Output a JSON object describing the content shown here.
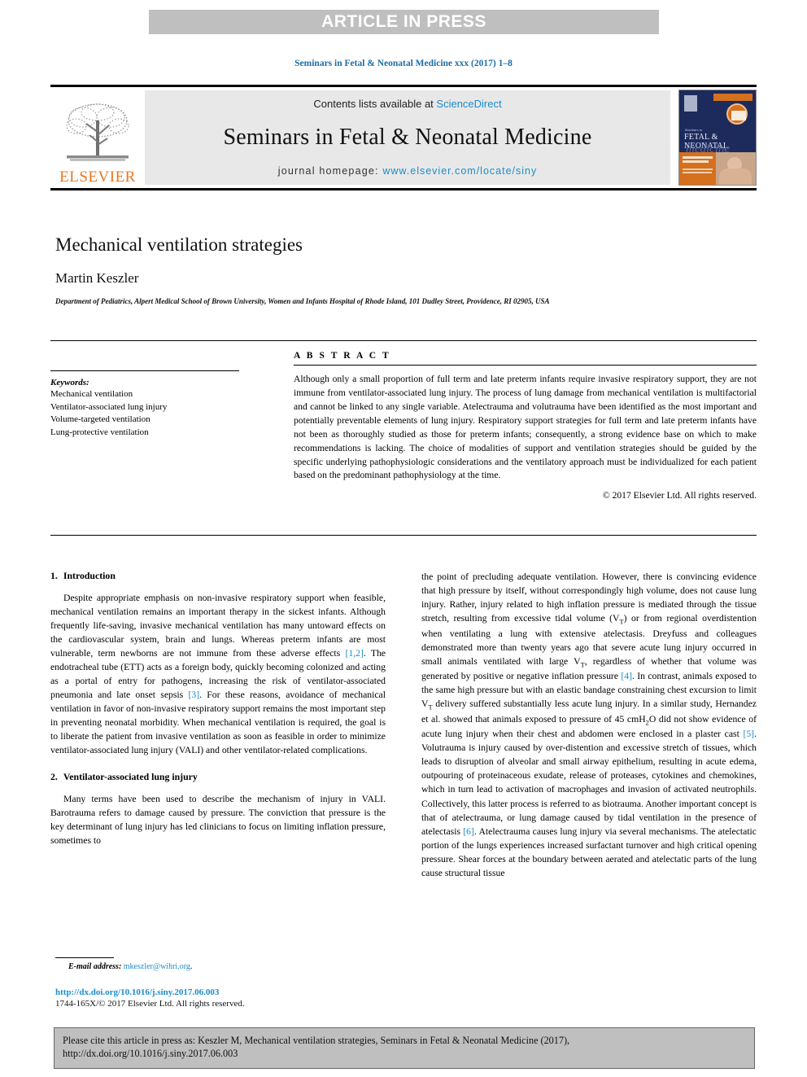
{
  "banner": {
    "label": "ARTICLE IN PRESS"
  },
  "running_head": "Seminars in Fetal & Neonatal Medicine xxx (2017) 1–8",
  "masthead": {
    "publisher_logo_text": "ELSEVIER",
    "contents_prefix": "Contents lists available at ",
    "contents_link": "ScienceDirect",
    "journal_name": "Seminars in Fetal & Neonatal Medicine",
    "homepage_prefix": "journal homepage: ",
    "homepage_url": "www.elsevier.com/locate/siny",
    "cover": {
      "title_small": "Seminars in",
      "title_main": "FETAL & NEONATAL",
      "title_script": "medicine"
    }
  },
  "article": {
    "title": "Mechanical ventilation strategies",
    "author": "Martin Keszler",
    "affiliation": "Department of Pediatrics, Alpert Medical School of Brown University, Women and Infants Hospital of Rhode Island, 101 Dudley Street, Providence, RI 02905, USA"
  },
  "keywords": {
    "heading": "Keywords:",
    "items": [
      "Mechanical ventilation",
      "Ventilator-associated lung injury",
      "Volume-targeted ventilation",
      "Lung-protective ventilation"
    ]
  },
  "abstract": {
    "heading": "A B S T R A C T",
    "text": "Although only a small proportion of full term and late preterm infants require invasive respiratory support, they are not immune from ventilator-associated lung injury. The process of lung damage from mechanical ventilation is multifactorial and cannot be linked to any single variable. Atelectrauma and volutrauma have been identified as the most important and potentially preventable elements of lung injury. Respiratory support strategies for full term and late preterm infants have not been as thoroughly studied as those for preterm infants; consequently, a strong evidence base on which to make recommendations is lacking. The choice of modalities of support and ventilation strategies should be guided by the specific underlying pathophysiologic considerations and the ventilatory approach must be individualized for each patient based on the predominant pathophysiology at the time.",
    "copyright": "© 2017 Elsevier Ltd. All rights reserved."
  },
  "sections": {
    "intro": {
      "number": "1.",
      "title": "Introduction"
    },
    "vali": {
      "number": "2.",
      "title": "Ventilator-associated lung injury"
    }
  },
  "body": {
    "left_p1_a": "Despite appropriate emphasis on non-invasive respiratory support when feasible, mechanical ventilation remains an important therapy in the sickest infants. Although frequently life-saving, invasive mechanical ventilation has many untoward effects on the cardiovascular system, brain and lungs. Whereas preterm infants are most vulnerable, term newborns are not immune from these adverse effects ",
    "left_p1_ref1": "[1,2]",
    "left_p1_b": ". The endotracheal tube (ETT) acts as a foreign body, quickly becoming colonized and acting as a portal of entry for pathogens, increasing the risk of ventilator-associated pneumonia and late onset sepsis ",
    "left_p1_ref2": "[3]",
    "left_p1_c": ". For these reasons, avoidance of mechanical ventilation in favor of non-invasive respiratory support remains the most important step in preventing neonatal morbidity. When mechanical ventilation is required, the goal is to liberate the patient from invasive ventilation as soon as feasible in order to minimize ventilator-associated lung injury (VALI) and other ventilator-related complications.",
    "left_p2": "Many terms have been used to describe the mechanism of injury in VALI. Barotrauma refers to damage caused by pressure. The conviction that pressure is the key determinant of lung injury has led clinicians to focus on limiting inflation pressure, sometimes to",
    "right_p1_a": "the point of precluding adequate ventilation. However, there is convincing evidence that high pressure by itself, without correspondingly high volume, does not cause lung injury. Rather, injury related to high inflation pressure is mediated through the tissue stretch, resulting from excessive tidal volume (V",
    "right_sub_T1": "T",
    "right_p1_b": ") or from regional overdistention when ventilating a lung with extensive atelectasis. Dreyfuss and colleagues demonstrated more than twenty years ago that severe acute lung injury occurred in small animals ventilated with large V",
    "right_sub_T2": "T",
    "right_p1_c": ", regardless of whether that volume was generated by positive or negative inflation pressure ",
    "right_ref4": "[4]",
    "right_p1_d": ". In contrast, animals exposed to the same high pressure but with an elastic bandage constraining chest excursion to limit V",
    "right_sub_T3": "T",
    "right_p1_e": " delivery suffered substantially less acute lung injury. In a similar study, Hernandez et al. showed that animals exposed to pressure of 45 cmH",
    "right_sub_2": "2",
    "right_p1_f": "O did not show evidence of acute lung injury when their chest and abdomen were enclosed in a plaster cast ",
    "right_ref5": "[5]",
    "right_p1_g": ". Volutrauma is injury caused by over-distention and excessive stretch of tissues, which leads to disruption of alveolar and small airway epithelium, resulting in acute edema, outpouring of proteinaceous exudate, release of proteases, cytokines and chemokines, which in turn lead to activation of macrophages and invasion of activated neutrophils. Collectively, this latter process is referred to as biotrauma. Another important concept is that of atelectrauma, or lung damage caused by tidal ventilation in the presence of atelectasis ",
    "right_ref6": "[6]",
    "right_p1_h": ". Atelectrauma causes lung injury via several mechanisms. The atelectatic portion of the lungs experiences increased surfactant turnover and high critical opening pressure. Shear forces at the boundary between aerated and atelectatic parts of the lung cause structural tissue"
  },
  "footer": {
    "email_label": "E-mail address:",
    "email_address": "mkeszler@wihri.org",
    "email_tail": ".",
    "doi_url": "http://dx.doi.org/10.1016/j.siny.2017.06.003",
    "issn_line": "1744-165X/© 2017 Elsevier Ltd. All rights reserved.",
    "citation": "Please cite this article in press as: Keszler M, Mechanical ventilation strategies, Seminars in Fetal & Neonatal Medicine (2017), http://dx.doi.org/10.1016/j.siny.2017.06.003"
  },
  "colors": {
    "link": "#1b8ccc",
    "banner_gray": "#bfbfbf",
    "elsevier_orange": "#e87722",
    "cover_navy": "#1d2a5c"
  }
}
